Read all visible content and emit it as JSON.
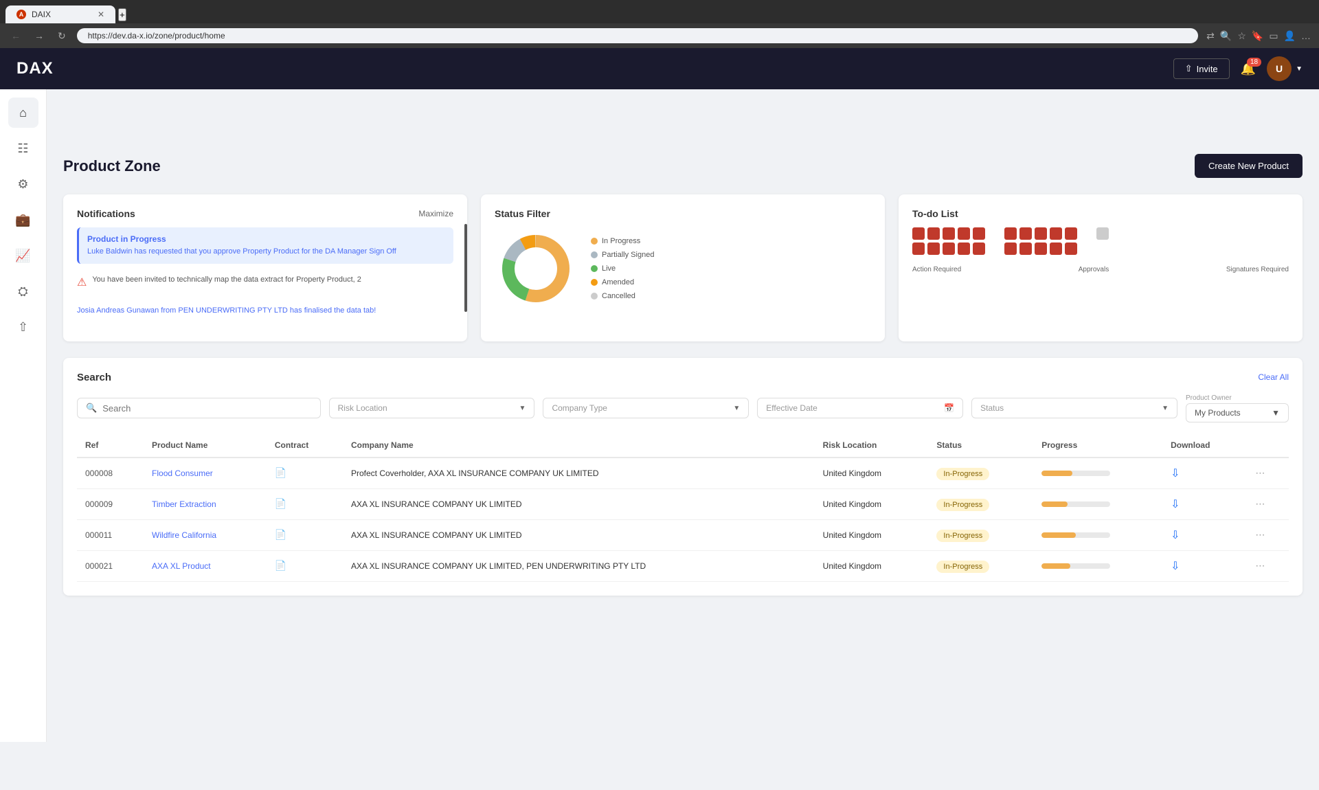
{
  "browser": {
    "tab_title": "DAIX",
    "tab_icon": "A",
    "url": "https://dev.da-x.io/zone/product/home"
  },
  "app": {
    "logo": "DAX",
    "nav": {
      "invite_label": "Invite",
      "notification_count": "18"
    }
  },
  "page": {
    "title": "Product Zone",
    "create_btn": "Create New Product"
  },
  "notifications": {
    "title": "Notifications",
    "maximize_label": "Maximize",
    "items": [
      {
        "type": "highlighted",
        "title": "Product in Progress",
        "body": "Luke Baldwin has requested that you approve Property Product for the DA Manager Sign Off"
      },
      {
        "type": "error",
        "body": "You have been invited to technically map the data extract for Property Product, 2"
      },
      {
        "type": "info",
        "body": "Josia Andreas Gunawan from PEN UNDERWRITING PTY LTD has finalised the data tab!"
      }
    ]
  },
  "status_filter": {
    "title": "Status Filter",
    "legend": [
      {
        "label": "In Progress",
        "color": "#f0ad4e"
      },
      {
        "label": "Partially Signed",
        "color": "#aab8c2"
      },
      {
        "label": "Live",
        "color": "#5cb85c"
      },
      {
        "label": "Amended",
        "color": "#f0ad4e"
      },
      {
        "label": "Cancelled",
        "color": "#cccccc"
      }
    ],
    "donut": {
      "segments": [
        {
          "color": "#5cb85c",
          "pct": 55
        },
        {
          "color": "#aab8c2",
          "pct": 15
        },
        {
          "color": "#f0ad4e",
          "pct": 20
        },
        {
          "color": "#e0e0e0",
          "pct": 10
        }
      ]
    }
  },
  "todo": {
    "title": "To-do List",
    "labels": [
      "Action Required",
      "Approvals",
      "Signatures Required"
    ],
    "dots_row1": [
      "red",
      "red",
      "red",
      "red",
      "red"
    ],
    "dots_row2": [
      "red",
      "red",
      "red",
      "red",
      "red"
    ]
  },
  "search": {
    "title": "Search",
    "clear_all_label": "Clear All",
    "search_placeholder": "Search",
    "risk_location_placeholder": "Risk Location",
    "company_type_placeholder": "Company Type",
    "effective_date_placeholder": "Effective Date",
    "status_placeholder": "Status",
    "product_owner_label": "Product Owner",
    "product_owner_value": "My Products"
  },
  "table": {
    "columns": [
      "Ref",
      "Product Name",
      "Contract",
      "Company Name",
      "Risk Location",
      "Status",
      "Progress",
      "Download"
    ],
    "rows": [
      {
        "ref": "000008",
        "product_name": "Flood Consumer",
        "company_name": "Profect Coverholder, AXA XL INSURANCE COMPANY UK LIMITED",
        "risk_location": "United Kingdom",
        "status": "In-Progress",
        "progress": 45
      },
      {
        "ref": "000009",
        "product_name": "Timber Extraction",
        "company_name": "AXA XL INSURANCE COMPANY UK LIMITED",
        "risk_location": "United Kingdom",
        "status": "In-Progress",
        "progress": 38
      },
      {
        "ref": "000011",
        "product_name": "Wildfire California",
        "company_name": "AXA XL INSURANCE COMPANY UK LIMITED",
        "risk_location": "United Kingdom",
        "status": "In-Progress",
        "progress": 50
      },
      {
        "ref": "000021",
        "product_name": "AXA XL Product",
        "company_name": "AXA XL INSURANCE COMPANY UK LIMITED, PEN UNDERWRITING PTY LTD",
        "risk_location": "United Kingdom",
        "status": "In-Progress",
        "progress": 42
      }
    ]
  }
}
